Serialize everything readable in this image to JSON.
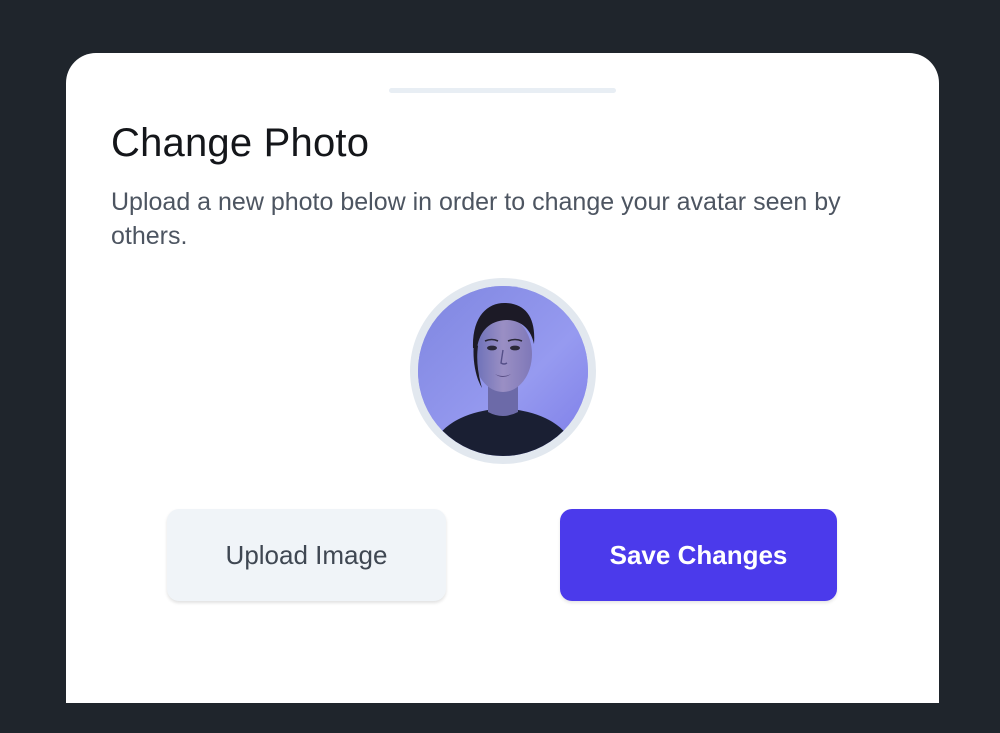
{
  "dialog": {
    "title": "Change Photo",
    "description": "Upload a new photo below in order to change your avatar seen by others."
  },
  "avatar": {
    "icon": "user-photo",
    "background_color": "#8f8fe6"
  },
  "actions": {
    "upload_label": "Upload Image",
    "save_label": "Save Changes"
  },
  "colors": {
    "backdrop": "#1f252c",
    "accent": "#4b3aeb",
    "secondary_button": "#f0f4f8"
  }
}
